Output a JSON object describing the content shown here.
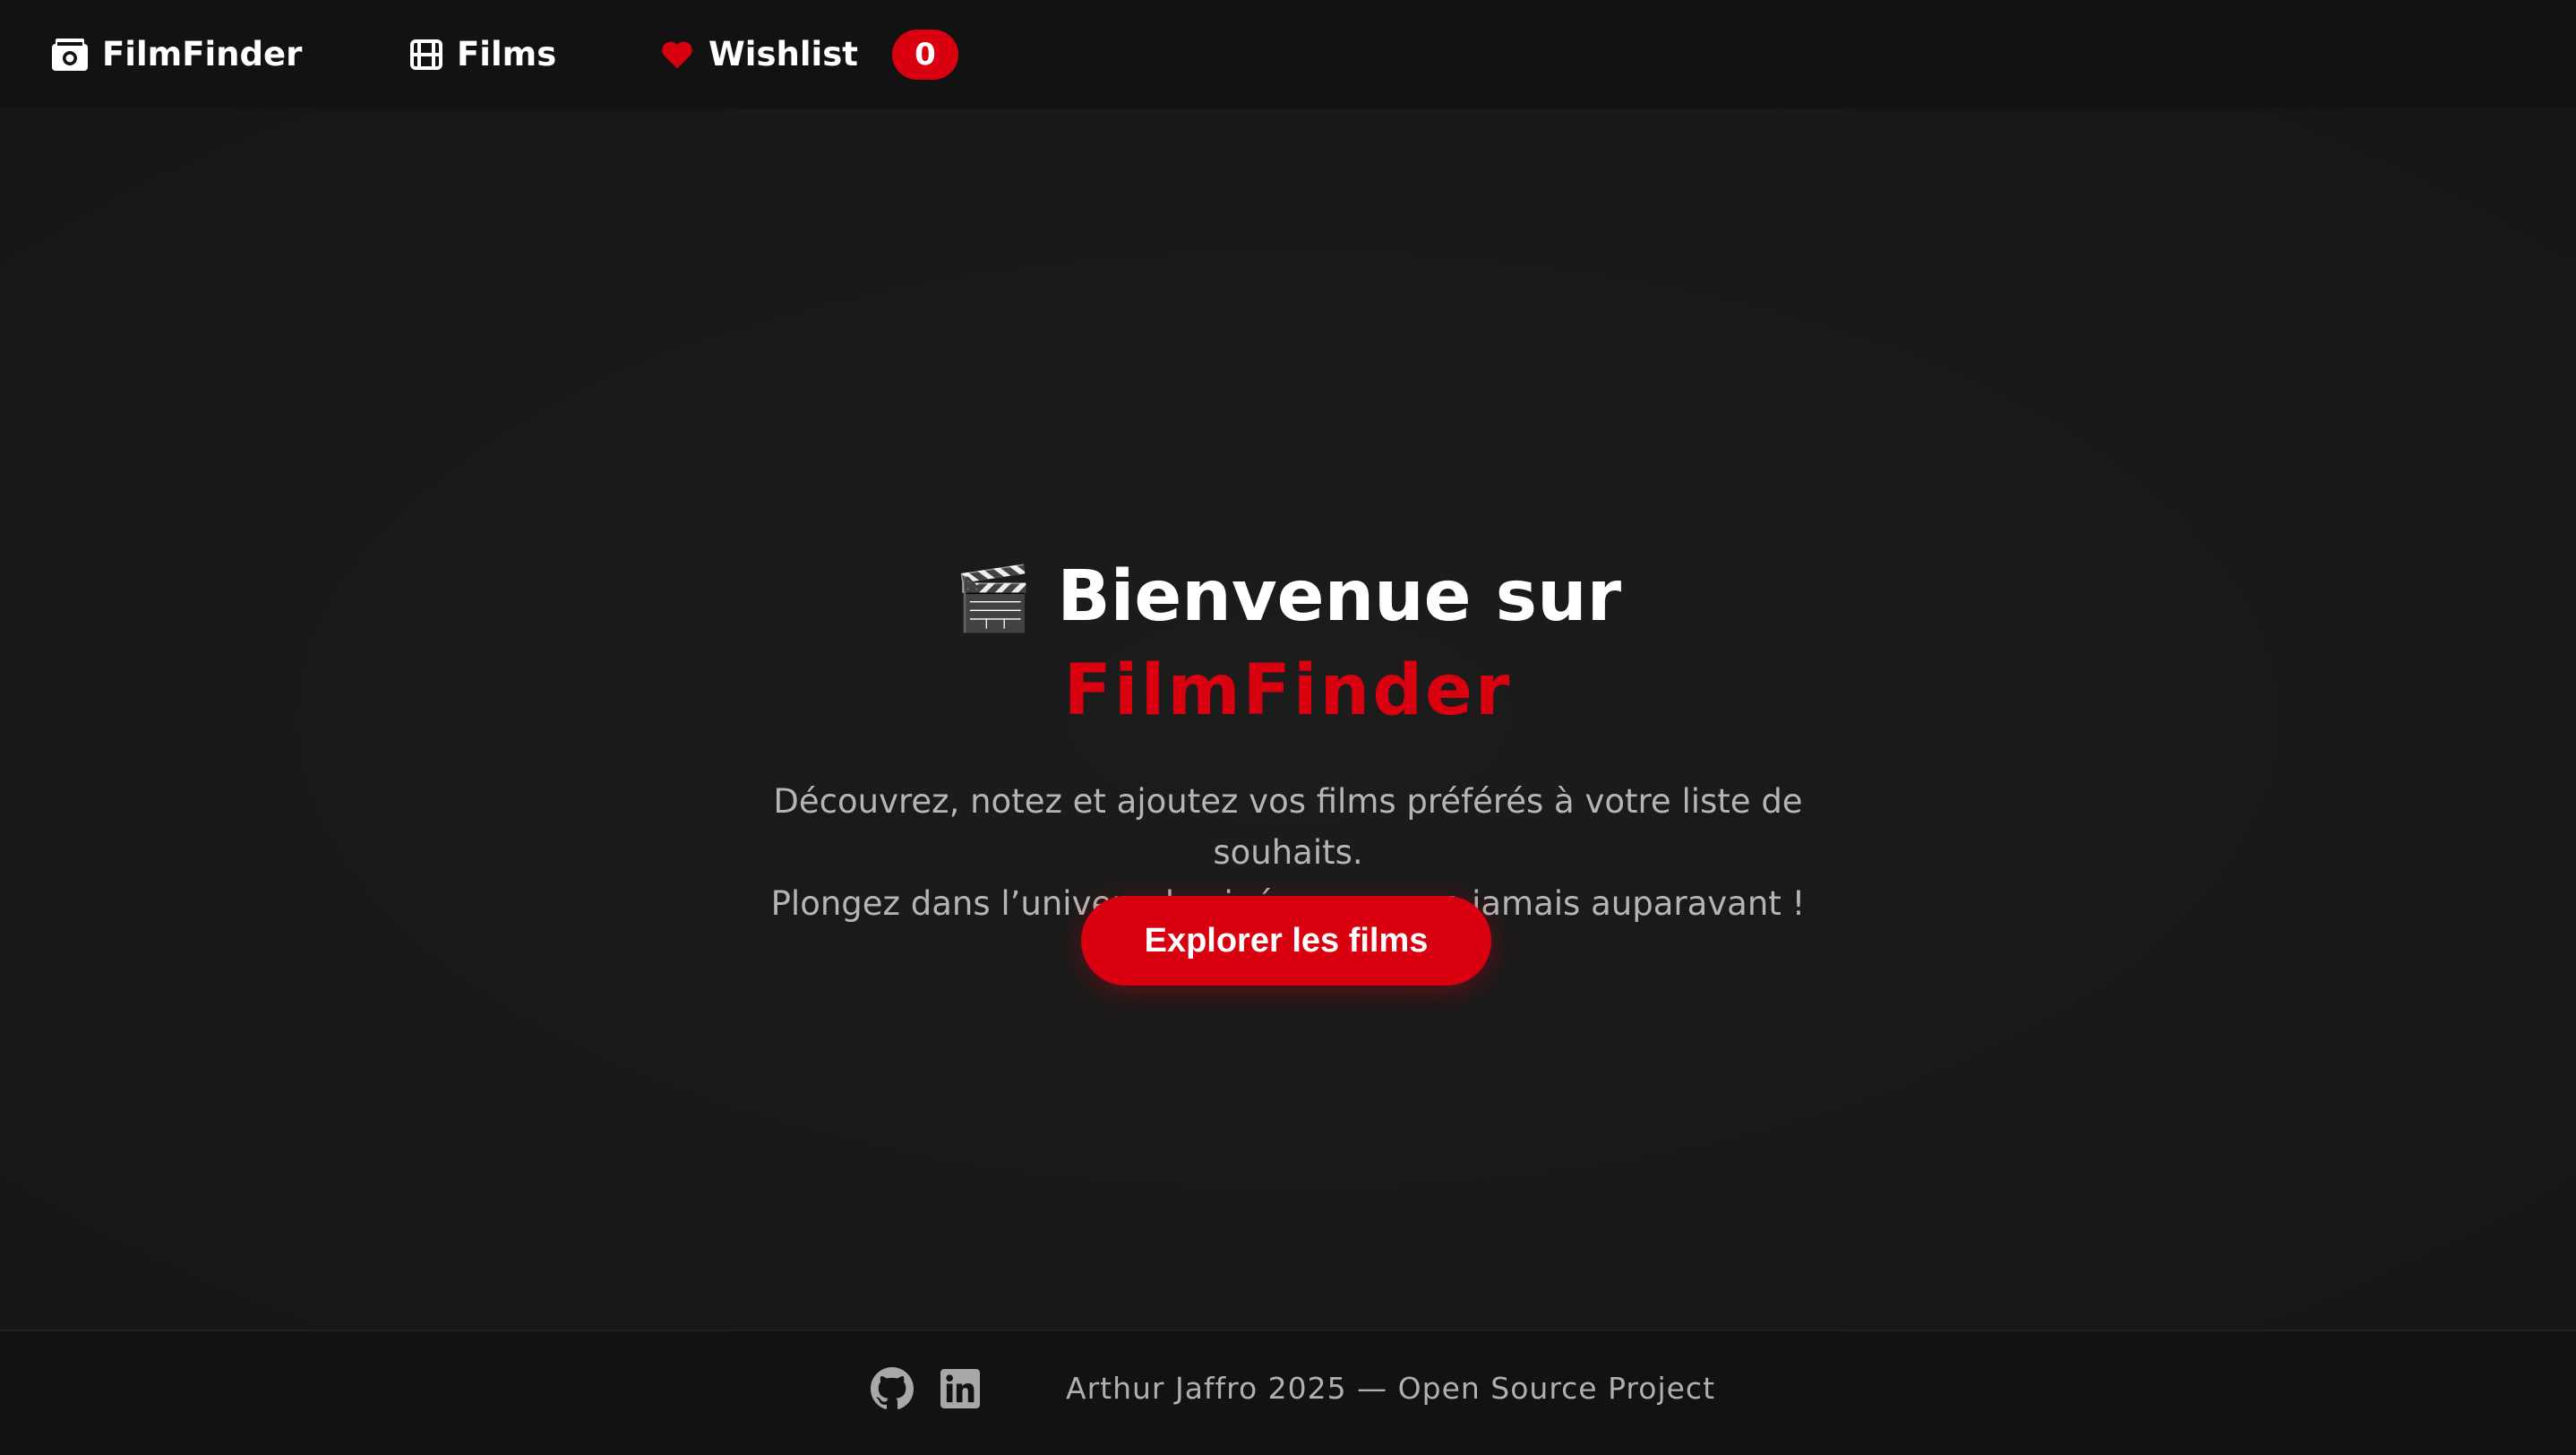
{
  "nav": {
    "brand": "FilmFinder",
    "films": "Films",
    "wishlist": "Wishlist",
    "wishlist_count": "0"
  },
  "hero": {
    "emoji": "🎬",
    "title_line1": "Bienvenue sur",
    "title_line2": "FilmFinder",
    "subtitle_line1": "Découvrez, notez et ajoutez vos films préférés à votre liste de",
    "subtitle_line2": "souhaits.",
    "subtitle_line3": "Plongez dans l’univers du cinéma comme jamais auparavant !",
    "cta": "Explorer les films"
  },
  "footer": {
    "text": "Arthur Jaffro 2025 — Open Source Project"
  },
  "colors": {
    "accent": "#d9000f",
    "background": "#181818",
    "navbar": "#121212"
  }
}
